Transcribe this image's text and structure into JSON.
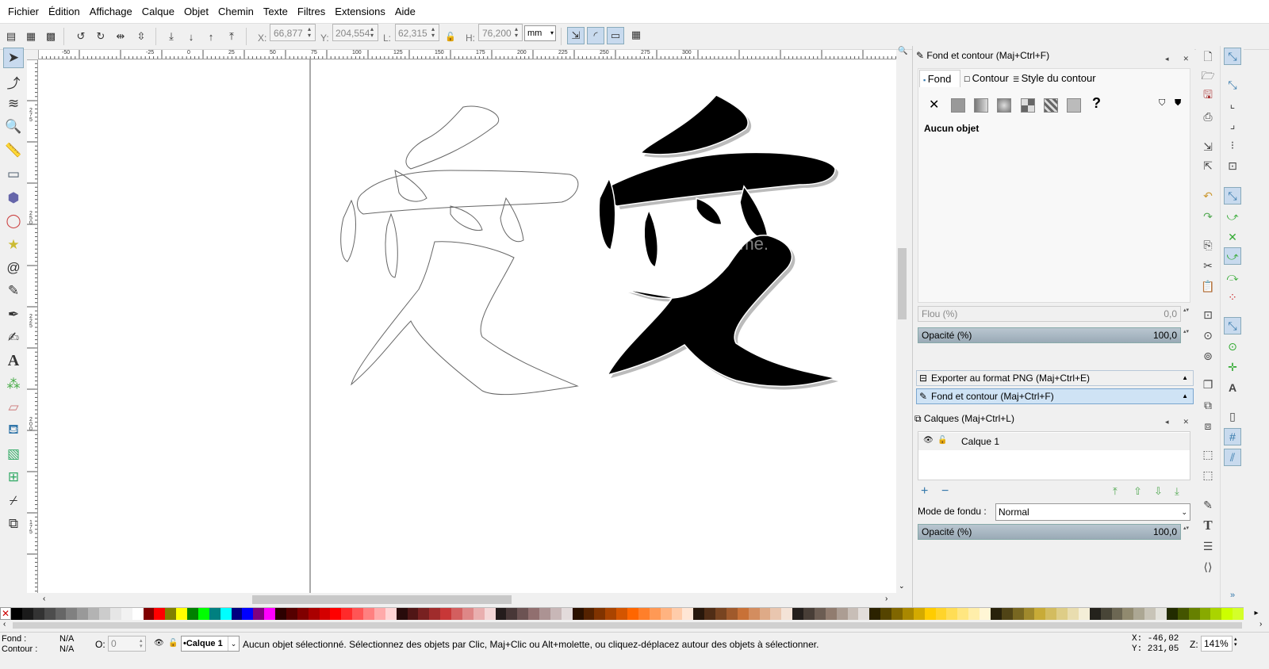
{
  "menu": [
    "Fichier",
    "Édition",
    "Affichage",
    "Calque",
    "Objet",
    "Chemin",
    "Texte",
    "Filtres",
    "Extensions",
    "Aide"
  ],
  "toolctl": {
    "x_label": "X:",
    "x_value": "66,877",
    "y_label": "Y:",
    "y_value": "204,554",
    "w_label": "L:",
    "w_value": "62,315",
    "h_label": "H:",
    "h_value": "76,200",
    "unit": "mm"
  },
  "ruler": {
    "h_ticks": [
      "-50",
      "-25",
      "0",
      "25",
      "50",
      "75",
      "100",
      "125",
      "150",
      "175",
      "200",
      "225",
      "250",
      "275",
      "300"
    ],
    "v_ticks": [
      "275",
      "250",
      "225",
      "200",
      "175"
    ]
  },
  "canvas": {
    "watermark": "dreamstime."
  },
  "fill_stroke": {
    "title": "Fond et contour (Maj+Ctrl+F)",
    "tabs": [
      "Fond",
      "Contour",
      "Style du contour"
    ],
    "empty_label": "Aucun objet",
    "blur_label": "Flou (%)",
    "blur_value": "0,0",
    "opacity_label": "Opacité (%)",
    "opacity_value": "100,0"
  },
  "export_png": "Exporter au format PNG (Maj+Ctrl+E)",
  "fill_stroke_expander": "Fond et contour (Maj+Ctrl+F)",
  "layers": {
    "title": "Calques (Maj+Ctrl+L)",
    "items": [
      "Calque 1"
    ],
    "blend_label": "Mode de fondu :",
    "blend_value": "Normal",
    "opacity_label": "Opacité (%)",
    "opacity_value": "100,0"
  },
  "status": {
    "fill_label": "Fond :",
    "fill_value": "N/A",
    "stroke_label": "Contour :",
    "stroke_value": "N/A",
    "o_label": "O:",
    "o_value": "0",
    "layer": "•Calque 1",
    "message": "Aucun objet sélectionné. Sélectionnez des objets par Clic, Maj+Clic ou Alt+molette, ou cliquez-déplacez autour des objets à sélectionner.",
    "cursor_x": "X: -46,02",
    "cursor_y": "Y: 231,05",
    "zoom_label": "Z:",
    "zoom_value": "141%"
  },
  "palette": [
    "#000000",
    "#1a1a1a",
    "#333333",
    "#4d4d4d",
    "#666666",
    "#808080",
    "#999999",
    "#b3b3b3",
    "#cccccc",
    "#e6e6e6",
    "#f2f2f2",
    "#ffffff",
    "#800000",
    "#ff0000",
    "#808000",
    "#ffff00",
    "#008000",
    "#00ff00",
    "#008080",
    "#00ffff",
    "#000080",
    "#0000ff",
    "#800080",
    "#ff00ff",
    "#2b0000",
    "#550000",
    "#800000",
    "#aa0000",
    "#d40000",
    "#ff0000",
    "#ff2a2a",
    "#ff5555",
    "#ff8080",
    "#ffaaaa",
    "#ffd5d5",
    "#280b0b",
    "#501616",
    "#782121",
    "#a02c2c",
    "#c83737",
    "#d35f5f",
    "#de8787",
    "#e9afaf",
    "#f4d7d7",
    "#241c1c",
    "#483737",
    "#6c5353",
    "#916f6f",
    "#ac9393",
    "#c8b7b7",
    "#e3dbdb",
    "#2b1100",
    "#552200",
    "#803300",
    "#aa4400",
    "#d45500",
    "#ff6600",
    "#ff7f2a",
    "#ff9955",
    "#ffb380",
    "#ffccaa",
    "#ffe6d5",
    "#28170b",
    "#502d16",
    "#784421",
    "#a05a2c",
    "#c87137",
    "#d38d5f",
    "#deaa87",
    "#e9c6af",
    "#f4e3d7",
    "#241f1c",
    "#483e37",
    "#6c5d53",
    "#917c6f",
    "#ac9d93",
    "#c8beb7",
    "#e3dedb",
    "#2b2200",
    "#554400",
    "#806600",
    "#aa8800",
    "#d4aa00",
    "#ffcc00",
    "#ffd42a",
    "#ffdd55",
    "#ffe680",
    "#ffeeaa",
    "#fff6d5",
    "#28220b",
    "#504416",
    "#786721",
    "#a0892c",
    "#c8ab37",
    "#d3bc5f",
    "#decd87",
    "#e9ddaf",
    "#f4eed7",
    "#24221c",
    "#484537",
    "#6c6753",
    "#918a6f",
    "#aca793",
    "#c8c4b7",
    "#e3e2db",
    "#222b00",
    "#445500",
    "#668000",
    "#88aa00",
    "#aad400",
    "#ccff00",
    "#d4ff2a"
  ]
}
